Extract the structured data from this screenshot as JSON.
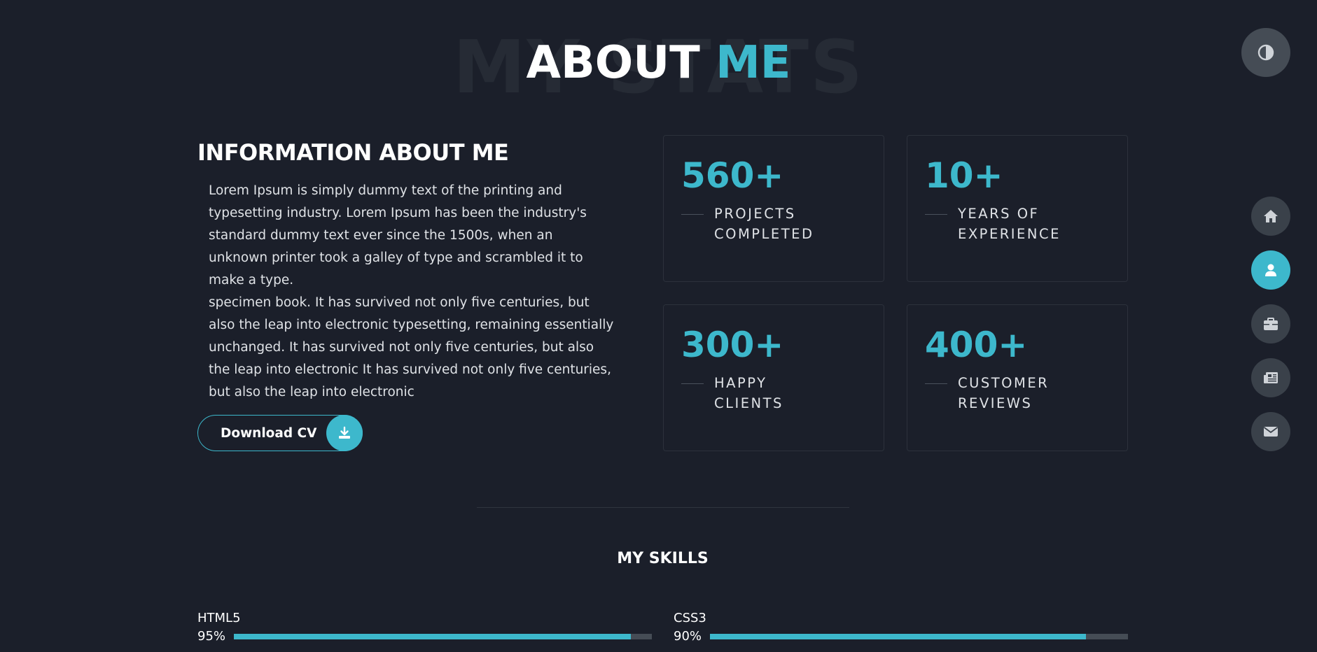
{
  "header": {
    "ghost_text": "MY STATS",
    "title_main": "ABOUT",
    "title_accent": "ME"
  },
  "theme_toggle": {
    "icon": "contrast-icon"
  },
  "nav": {
    "items": [
      {
        "id": "home",
        "icon": "home-icon",
        "active": false
      },
      {
        "id": "about",
        "icon": "user-icon",
        "active": true
      },
      {
        "id": "portfolio",
        "icon": "briefcase-icon",
        "active": false
      },
      {
        "id": "blog",
        "icon": "newspaper-icon",
        "active": false
      },
      {
        "id": "contact",
        "icon": "envelope-icon",
        "active": false
      }
    ]
  },
  "info": {
    "title": "INFORMATION ABOUT ME",
    "paragraph_1": "Lorem Ipsum is simply dummy text of the printing and typesetting industry. Lorem Ipsum has been the industry's standard dummy text ever since the 1500s, when an unknown printer took a galley of type and scrambled it to make a type.",
    "paragraph_2": "specimen book. It has survived not only five centuries, but also the leap into electronic typesetting, remaining essentially unchanged. It has survived not only five centuries, but also the leap into electronic It has survived not only five centuries, but also the leap into electronic",
    "download_label": "Download CV",
    "download_icon": "download-icon"
  },
  "stats": [
    {
      "value": "560+",
      "label": "PROJECTS\nCOMPLETED"
    },
    {
      "value": "10+",
      "label": "YEARS OF\nEXPERIENCE"
    },
    {
      "value": "300+",
      "label": "HAPPY\nCLIENTS"
    },
    {
      "value": "400+",
      "label": "CUSTOMER\nREVIEWS"
    }
  ],
  "skills": {
    "title": "MY SKILLS",
    "items": [
      {
        "name": "HTML5",
        "percent_label": "95%",
        "level": 0.95
      },
      {
        "name": "CSS3",
        "percent_label": "90%",
        "level": 0.9
      }
    ]
  },
  "colors": {
    "background": "#1b1f2a",
    "accent": "#3db8cc",
    "nav_bg": "#3a414a"
  }
}
